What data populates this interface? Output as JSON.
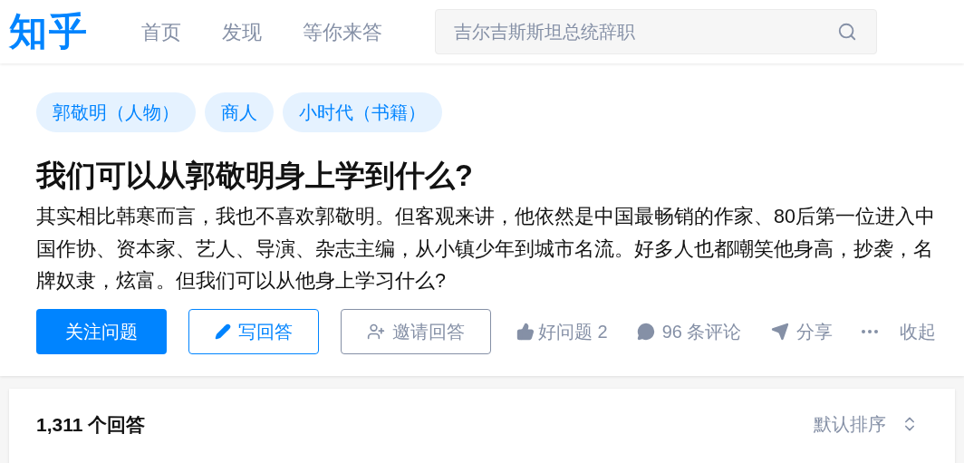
{
  "logo": "知乎",
  "nav": [
    {
      "label": "首页",
      "selected": false
    },
    {
      "label": "发现",
      "selected": false
    },
    {
      "label": "等你来答",
      "selected": false
    }
  ],
  "search": {
    "placeholder": "吉尔吉斯斯坦总统辞职"
  },
  "question": {
    "topics": [
      "郭敬明（人物）",
      "商人",
      "小时代（书籍）"
    ],
    "title": "我们可以从郭敬明身上学到什么?",
    "detail": "其实相比韩寒而言，我也不喜欢郭敬明。但客观来讲，他依然是中国最畅销的作家、80后第一位进入中国作协、资本家、艺人、导演、杂志主编，从小镇少年到城市名流。好多人也都嘲笑他身高，抄袭，名牌奴隶，炫富。但我们可以从他身上学习什么?",
    "actions": [
      {
        "kind": "follow",
        "label": "关注问题"
      },
      {
        "kind": "write",
        "label": "写回答"
      },
      {
        "kind": "invite",
        "label": "邀请回答"
      },
      {
        "kind": "like",
        "label": "好问题 2"
      },
      {
        "kind": "comment",
        "label": "96 条评论"
      },
      {
        "kind": "share",
        "label": "分享"
      },
      {
        "kind": "more"
      },
      {
        "kind": "collapse",
        "label": "收起"
      }
    ]
  },
  "answers": {
    "count": "1,311 个回答",
    "sort": "默认排序"
  }
}
